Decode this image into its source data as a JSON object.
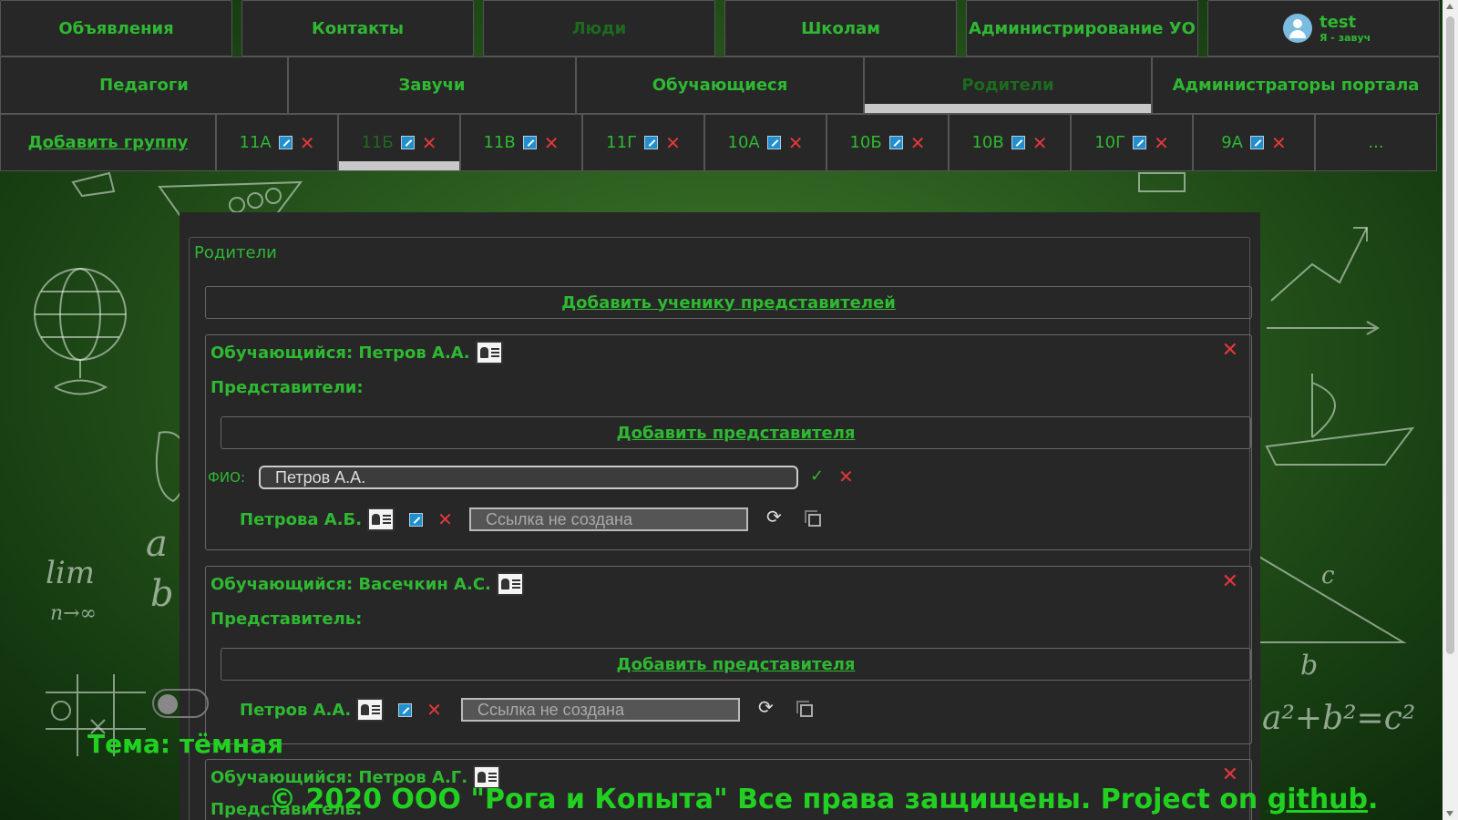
{
  "nav": {
    "top": [
      {
        "label": "Объявления"
      },
      {
        "label": "Контакты"
      },
      {
        "label": "Люди"
      },
      {
        "label": "Школам"
      },
      {
        "label": "Администрирование УО"
      }
    ],
    "user": {
      "name": "test",
      "role": "Я - завуч"
    },
    "sub": [
      {
        "label": "Педагоги"
      },
      {
        "label": "Завучи"
      },
      {
        "label": "Обучающиеся"
      },
      {
        "label": "Родители"
      },
      {
        "label": "Администраторы портала"
      }
    ],
    "add_group": "Добавить группу",
    "groups": [
      "11А",
      "11Б",
      "11В",
      "11Г",
      "10А",
      "10Б",
      "10В",
      "10Г",
      "9А"
    ],
    "more": "..."
  },
  "panel": {
    "title": "Родители",
    "add_student_reps": "Добавить ученику представителей",
    "cards": [
      {
        "student": "Обучающийся: Петров А.А.",
        "reps_label": "Представители:",
        "add_rep": "Добавить представителя",
        "edit_label": "ФИО:",
        "edit_value": "Петров А.А.",
        "rep_name": "Петрова А.Б.",
        "link_placeholder": "Ссылка не создана"
      },
      {
        "student": "Обучающийся: Васечкин А.С.",
        "reps_label": "Представитель:",
        "add_rep": "Добавить представителя",
        "rep_name": "Петров А.А.",
        "link_placeholder": "Ссылка не создана"
      },
      {
        "student": "Обучающийся: Петров А.Г.",
        "reps_label": "Представитель:"
      }
    ]
  },
  "theme_label": "Тема: тёмная",
  "footer": {
    "text": "© 2020 ООО \"Рога и Копыта\" Все права защищены. Project on ",
    "link": "github",
    "end": "."
  },
  "colors": {
    "accent": "#2fb832",
    "danger": "#e2383a",
    "panel": "#272727"
  }
}
